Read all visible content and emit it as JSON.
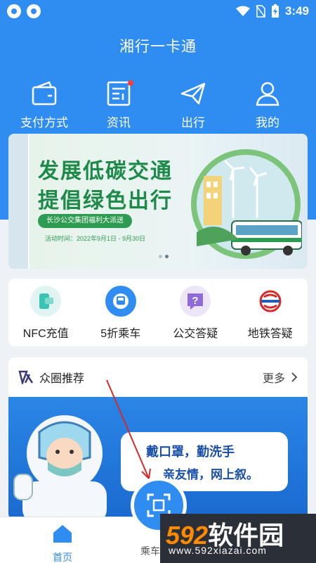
{
  "status_bar": {
    "time": "3:49"
  },
  "app": {
    "title": "湘行一卡通"
  },
  "topnav": [
    {
      "label": "支付方式",
      "icon": "wallet-icon"
    },
    {
      "label": "资讯",
      "icon": "news-icon",
      "badge": true
    },
    {
      "label": "出行",
      "icon": "paper-plane-icon"
    },
    {
      "label": "我的",
      "icon": "user-icon"
    }
  ],
  "banner": {
    "line1": "发展低碳交通",
    "line2": "提倡绿色出行",
    "pill": "长沙公交集团福利大派送",
    "date": "活动时间：2022年9月1日 - 9月30日",
    "colors": {
      "text": "#1e8a4a"
    }
  },
  "quick": [
    {
      "label": "NFC充值",
      "icon": "nfc-card-icon",
      "color": "#dff4f3"
    },
    {
      "label": "5折乘车",
      "icon": "bus-discount-icon",
      "color": "#2f8cf0",
      "badge": "5折乘车"
    },
    {
      "label": "公交答疑",
      "icon": "question-icon",
      "color": "#8f6ad8"
    },
    {
      "label": "地铁答疑",
      "icon": "metro-logo-icon",
      "color": "#d52a2a"
    }
  ],
  "zone": {
    "title": "众圈推荐",
    "more": "更多",
    "poster_line1": "戴口罩，勤洗手",
    "poster_line2": "亲友情，网上叙。"
  },
  "bottom_nav": [
    {
      "label": "首页",
      "icon": "home-icon",
      "active": true
    },
    {
      "label": "乘车",
      "icon": "scan-icon",
      "active": false
    }
  ],
  "watermark": {
    "logo": "592",
    "logo_cn": "软件园",
    "url": "www.592xiazai.com"
  },
  "colors": {
    "primary": "#2f8cf0",
    "active_tab": "#2f8cf0"
  }
}
